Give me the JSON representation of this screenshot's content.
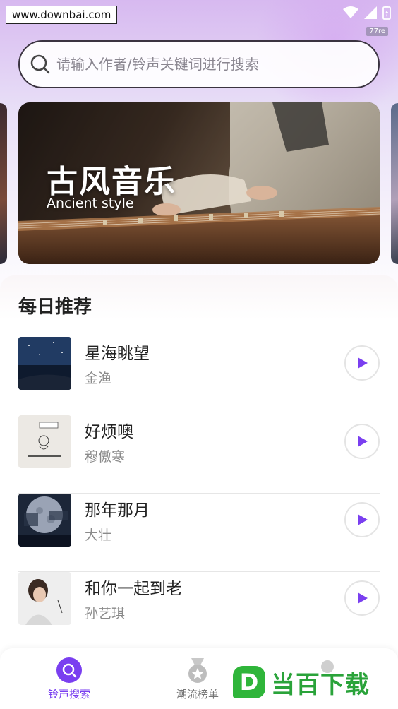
{
  "status": {
    "watermark": "www.downbai.com",
    "net_speed": "77re"
  },
  "search": {
    "placeholder": "请输入作者/铃声关键词进行搜索"
  },
  "banner": {
    "title": "古风音乐",
    "subtitle": "Ancient style"
  },
  "section": {
    "title": "每日推荐"
  },
  "songs": [
    {
      "title": "星海眺望",
      "artist": "金渔"
    },
    {
      "title": "好烦噢",
      "artist": "穆傲寒"
    },
    {
      "title": "那年那月",
      "artist": "大壮"
    },
    {
      "title": "和你一起到老",
      "artist": "孙艺琪"
    }
  ],
  "nav": {
    "items": [
      {
        "label": "铃声搜索"
      },
      {
        "label": "潮流榜单"
      }
    ]
  },
  "brand": {
    "mark": "D",
    "name": "当百下载"
  },
  "colors": {
    "accent": "#7a3ff0",
    "brand_green": "#2fb53a"
  }
}
